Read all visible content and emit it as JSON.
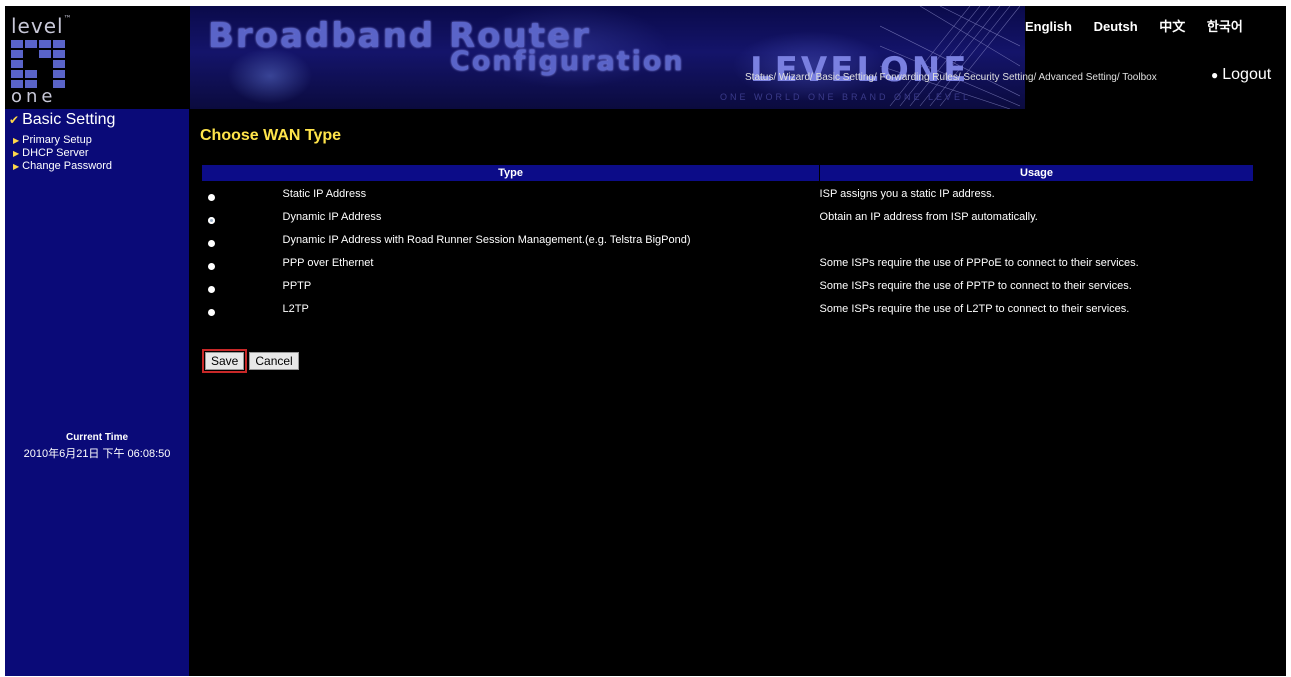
{
  "header": {
    "logo_top": "level",
    "logo_tm": "™",
    "logo_bottom": "one",
    "banner_title": "Broadband Router",
    "banner_sub": "Configuration",
    "brand": "LEVELONE",
    "brand_tag": "ONE WORLD  ONE BRAND  ONE LEVEL",
    "languages": [
      "English",
      "Deutsh",
      "中文",
      "한국어"
    ],
    "topnav": "Status/ Wizard/ Basic Setting/ Forwarding Rules/ Security Setting/ Advanced Setting/ Toolbox",
    "logout_label": "Logout"
  },
  "sidebar": {
    "section_title": "Basic Setting",
    "items": [
      {
        "label": "Primary Setup"
      },
      {
        "label": "DHCP Server"
      },
      {
        "label": "Change Password"
      }
    ],
    "time_label": "Current Time",
    "time_value": "2010年6月21日 下午 06:08:50"
  },
  "main": {
    "page_title": "Choose WAN Type",
    "columns": [
      "Type",
      "Usage"
    ],
    "rows": [
      {
        "type": "Static IP Address",
        "usage": "ISP assigns you a static IP address.",
        "selected": false
      },
      {
        "type": "Dynamic IP Address",
        "usage": "Obtain an IP address from ISP automatically.",
        "selected": true
      },
      {
        "type": "Dynamic IP Address with Road Runner Session Management.(e.g. Telstra BigPond)",
        "usage": "",
        "selected": false
      },
      {
        "type": "PPP over Ethernet",
        "usage": "Some ISPs require the use of PPPoE to connect to their services.",
        "selected": false
      },
      {
        "type": "PPTP",
        "usage": "Some ISPs require the use of PPTP to connect to their services.",
        "selected": false
      },
      {
        "type": "L2TP",
        "usage": "Some ISPs require the use of L2TP to connect to their services.",
        "selected": false
      }
    ],
    "save_label": "Save",
    "cancel_label": "Cancel"
  },
  "colors": {
    "sidebar_bg": "#0a0a78",
    "table_header_bg": "#0c0c88",
    "title_yellow": "#ffe44a",
    "save_highlight": "#c82828"
  }
}
